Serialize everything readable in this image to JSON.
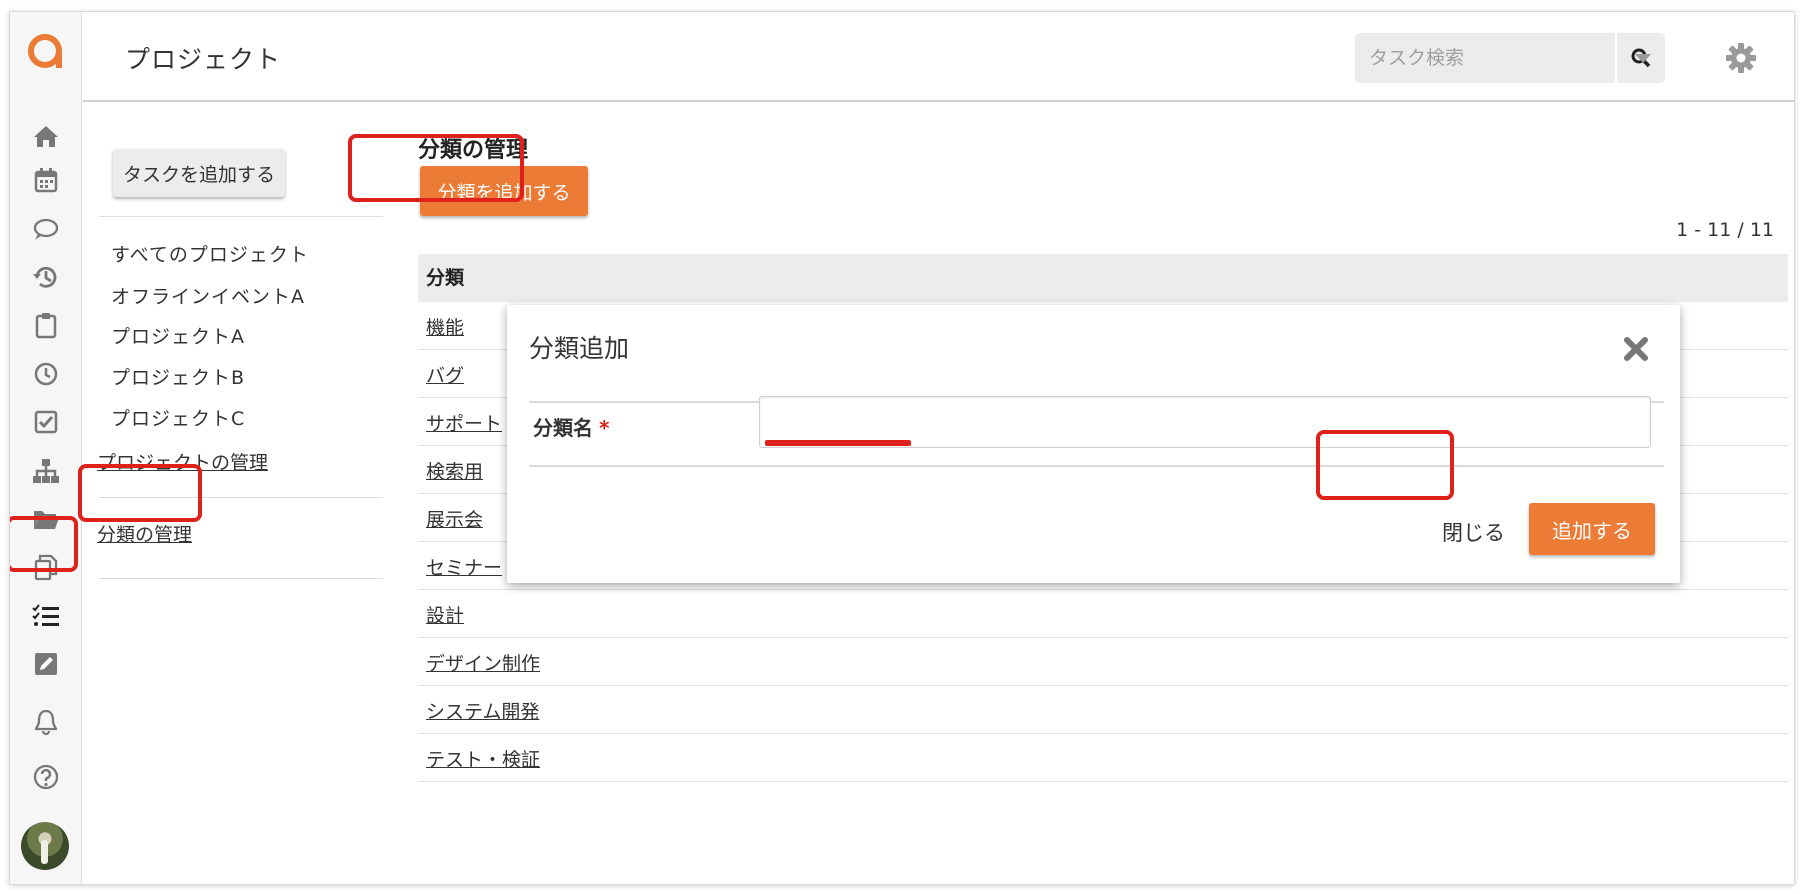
{
  "header": {
    "title": "プロジェクト",
    "search_placeholder": "タスク検索"
  },
  "rail": {
    "icons": [
      "home-icon",
      "calendar-icon",
      "chat-icon",
      "history-icon",
      "clipboard-icon",
      "clock-icon",
      "checkbox-icon",
      "org-chart-icon",
      "folder-icon",
      "copy-icon",
      "task-list-icon",
      "edit-icon",
      "bell-icon",
      "help-icon"
    ],
    "active": "task-list-icon"
  },
  "subnav": {
    "add_task_label": "タスクを追加する",
    "projects": [
      "すべてのプロジェクト",
      "オフラインイベントA",
      "プロジェクトA",
      "プロジェクトB",
      "プロジェクトC"
    ],
    "manage_projects_label": "プロジェクトの管理",
    "manage_categories_label": "分類の管理"
  },
  "main": {
    "title": "分類の管理",
    "add_category_label": "分類を追加する",
    "count": "1 - 11 / 11",
    "table_header": "分類",
    "rows": [
      "機能",
      "バグ",
      "サポート",
      "検索用",
      "展示会",
      "セミナー",
      "設計",
      "デザイン制作",
      "システム開発",
      "テスト・検証"
    ]
  },
  "modal": {
    "title": "分類追加",
    "field_label": "分類名",
    "required_mark": "*",
    "field_value": "",
    "close_label": "閉じる",
    "submit_label": "追加する"
  },
  "colors": {
    "accent": "#ec7b35",
    "highlight": "#e0201b"
  }
}
